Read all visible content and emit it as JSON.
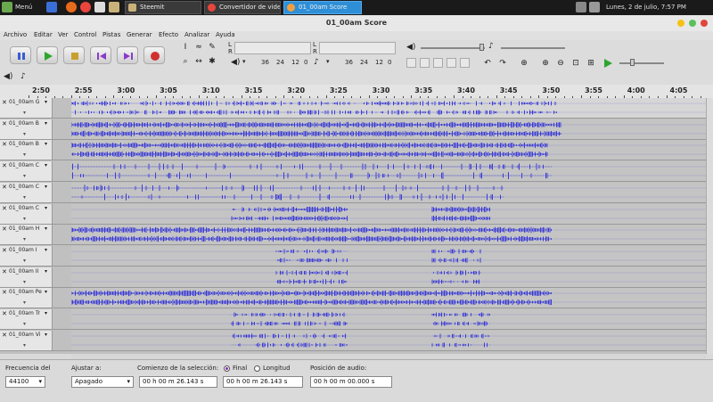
{
  "taskbar": {
    "menu_label": "Menú",
    "tasks": [
      {
        "label": "Steemit",
        "active": false
      },
      {
        "label": "Convertidor de vide...",
        "active": false
      },
      {
        "label": "01_00am Score",
        "active": true
      }
    ],
    "clock": "Lunes,  2 de julio,  7:57 PM"
  },
  "window": {
    "title": "01_00am Score"
  },
  "menu": [
    "Archivo",
    "Editar",
    "Ver",
    "Control",
    "Pistas",
    "Generar",
    "Efecto",
    "Analizar",
    "Ayuda"
  ],
  "meters": {
    "record_scale": [
      "36",
      "24",
      "12",
      "0"
    ],
    "play_scale": [
      "36",
      "24",
      "12",
      "0"
    ],
    "l": "L",
    "r": "R"
  },
  "ruler": [
    "2:50",
    "2:55",
    "3:00",
    "3:05",
    "3:10",
    "3:15",
    "3:20",
    "3:25",
    "3:30",
    "3:35",
    "3:40",
    "3:45",
    "3:50",
    "3:55",
    "4:00",
    "4:05"
  ],
  "tracks": [
    {
      "name": "01_00am G"
    },
    {
      "name": "01_00am B"
    },
    {
      "name": "01_00am B"
    },
    {
      "name": "01_00am C"
    },
    {
      "name": "01_00am C"
    },
    {
      "name": "01_00am C"
    },
    {
      "name": "01_00am H"
    },
    {
      "name": "01_00am I"
    },
    {
      "name": "01_00am II"
    },
    {
      "name": "01_00am Pe"
    },
    {
      "name": "01_00am Tr"
    },
    {
      "name": "01_00am Vi"
    }
  ],
  "selection_bar": {
    "rate_label": "Frecuencia del",
    "rate_value": "44100",
    "snap_label": "Ajustar a:",
    "snap_value": "Apagado",
    "sel_start_label": "Comienzo de la selección:",
    "end_label": "Final",
    "length_label": "Longitud",
    "sel_start_value": "00 h 00 m 26.143 s",
    "sel_end_value": "00 h 00 m 26.143 s",
    "audio_pos_label": "Posición de audio:",
    "audio_pos_value": "00 h 00 m 00.000 s"
  },
  "colors": {
    "waveform": "#3a3ad6",
    "active_task": "#2e8fd6",
    "selected_radio": "#8a2bb8"
  }
}
